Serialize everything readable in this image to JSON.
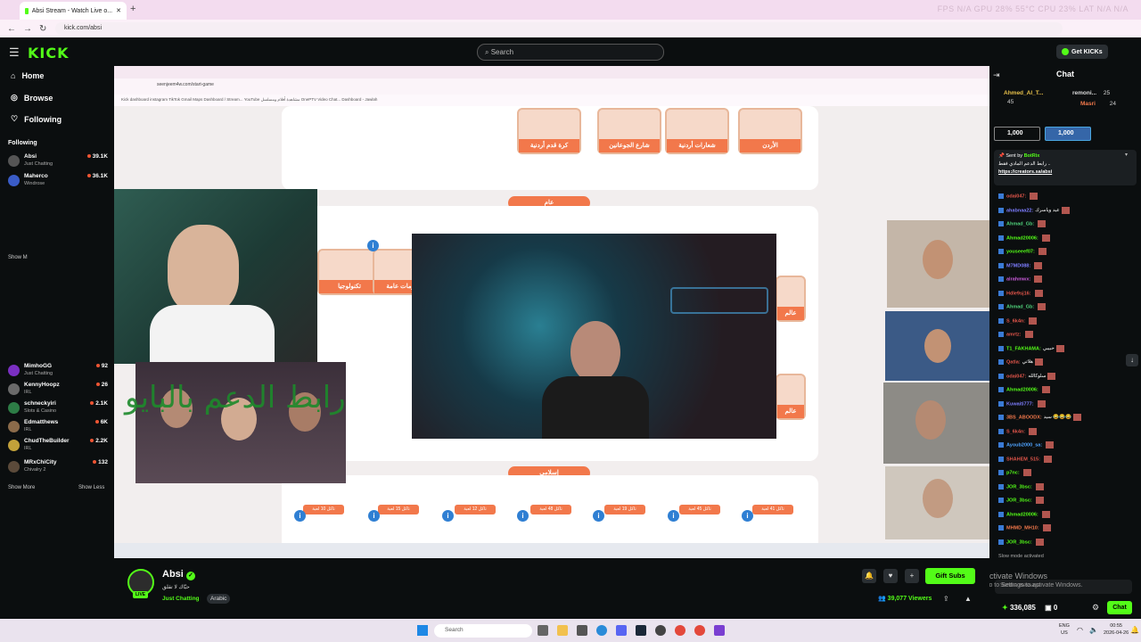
{
  "browser": {
    "tab_title": "Absi Stream - Watch Live o...",
    "url": "kick.com/absi",
    "perf_overlay": "FPS N/A   GPU 28% 55°C   CPU 23%   LAT N/A  N/A"
  },
  "kick": {
    "logo": "KICK",
    "search_placeholder": "Search",
    "get_kicks": "Get KICKs"
  },
  "sidebar": {
    "nav": [
      {
        "label": "Home",
        "icon": "home-icon"
      },
      {
        "label": "Browse",
        "icon": "compass-icon"
      },
      {
        "label": "Following",
        "icon": "heart-icon"
      }
    ],
    "following_header": "Following",
    "following": [
      {
        "name": "Absi",
        "category": "Just Chatting",
        "viewers": "39.1K"
      },
      {
        "name": "Maherco",
        "category": "Windrose",
        "viewers": "36.1K"
      }
    ],
    "recommended": [
      {
        "name": "MimhoGG",
        "category": "Just Chatting",
        "viewers": "92"
      },
      {
        "name": "KennyHoopz",
        "category": "IRL",
        "viewers": "26"
      },
      {
        "name": "schneckyiri",
        "category": "Slots & Casino",
        "viewers": "2.1K"
      },
      {
        "name": "Edmatthews",
        "category": "IRL",
        "viewers": "6K"
      },
      {
        "name": "ChudTheBuilder",
        "category": "IRL",
        "viewers": "2.2K"
      },
      {
        "name": "MRxChiCity",
        "category": "Chivalry 2",
        "viewers": "132"
      }
    ],
    "show_more_1": "Show M",
    "show_more": "Show More",
    "show_less": "Show Less"
  },
  "stream_content": {
    "inner_url": "seenjeem4w.com/start-game",
    "bookmarks": "Kick   dashboard   instagram   TikTok   Gmail   Maps   Dashboard / Stream...   YouTube   مشاهدة أفلام ومسلسل   OnePTV Video Chat...   Dashboard - Jawlah",
    "cards_top": [
      "الأردن",
      "شعارات أردنية",
      "شارع الجوعانين",
      "كرة قدم أردنية"
    ],
    "section_general": "عام",
    "cards_mid": [
      "تكنولوجيا",
      "معلومات عامة",
      "عالم",
      "عالم"
    ],
    "section_islamic": "إسلامي",
    "tags_bottom": [
      "تاكل 10 لعبة",
      "تاكل 15 لعبة",
      "تاكل 12 لعبة",
      "تاكل 48 لعبة",
      "تاكل 19 لعبة",
      "تاكل 45 لعبة",
      "تاكل 41 لعبة"
    ],
    "overlay_arabic": "رابط الدعم بالبايو"
  },
  "stream_info": {
    "name": "Absi",
    "title": "حيّاك لا تقلق",
    "category": "Just Chatting",
    "language": "Arabic",
    "live": "LIVE",
    "gift_subs": "Gift Subs",
    "viewers": "39,077 Viewers"
  },
  "chat": {
    "title": "Chat",
    "top_gifters": [
      {
        "name": "Ahmed_Al_T...",
        "count": "45"
      },
      {
        "name": "remoni...",
        "count": "25"
      },
      {
        "name": "Masri",
        "count": "24"
      }
    ],
    "goal_left": "1,000",
    "goal_right": "1,000",
    "pinned_by": "Sent by",
    "pinned_user": "BotRix",
    "pinned_text": "رابط الدعم المادي فقط ..",
    "pinned_link": "https://creators.sa/absi",
    "pinned_text2": "رابط الدعم المادي باي ...",
    "messages": [
      {
        "user": "odai047:",
        "text": "",
        "color": "#e0554a"
      },
      {
        "user": "ahabnaa22:",
        "text": "عيد وياسرك",
        "color": "#7d7dff"
      },
      {
        "user": "Ahmad_Gb:",
        "text": "",
        "color": "#4fd17a"
      },
      {
        "user": "Ahmad20006:",
        "text": "",
        "color": "#53fc18"
      },
      {
        "user": "youseeef07:",
        "text": "",
        "color": "#53fc18"
      },
      {
        "user": "M7MD088:",
        "text": "",
        "color": "#7d7dff"
      },
      {
        "user": "alrahmwx:",
        "text": "",
        "color": "#c85ad9"
      },
      {
        "user": "HdIe9sj16:",
        "text": "",
        "color": "#e0554a"
      },
      {
        "user": "Ahmad_Gb:",
        "text": "",
        "color": "#4fd17a"
      },
      {
        "user": "S_6k4n:",
        "text": "",
        "color": "#e0554a"
      },
      {
        "user": "amrtz:",
        "text": "",
        "color": "#e0554a"
      },
      {
        "user": "T1_FAKHAMA:",
        "text": "حبيبي",
        "color": "#53fc18"
      },
      {
        "user": "Qatla:",
        "text": "هلاتي",
        "color": "#e0554a"
      },
      {
        "user": "odai047:",
        "text": "سلوكالله",
        "color": "#e0554a"
      },
      {
        "user": "Ahmad20006:",
        "text": "",
        "color": "#53fc18"
      },
      {
        "user": "Kuwaiti777:",
        "text": "",
        "color": "#7d7dff"
      },
      {
        "user": "3BS_ABOODX:",
        "text": "سيد 😂😂😂",
        "color": "#f2784b"
      },
      {
        "user": "S_6k4n:",
        "text": "",
        "color": "#e0554a"
      },
      {
        "user": "Ayoub2000_sa:",
        "text": "",
        "color": "#4fa3ff"
      },
      {
        "user": "SHAHEM_515:",
        "text": "",
        "color": "#e0554a"
      },
      {
        "user": "p7nc:",
        "text": "",
        "color": "#53fc18"
      },
      {
        "user": "JOR_3bsc:",
        "text": "",
        "color": "#53fc18"
      },
      {
        "user": "JOR_3bsc:",
        "text": "",
        "color": "#53fc18"
      },
      {
        "user": "Ahmad20006:",
        "text": "",
        "color": "#53fc18"
      },
      {
        "user": "MHMD_MH10:",
        "text": "",
        "color": "#f2784b"
      },
      {
        "user": "JOR_3bsc:",
        "text": "",
        "color": "#53fc18"
      }
    ],
    "slow_mode": "Slow mode activated",
    "input_placeholder": "Send a message",
    "points": "336,085",
    "points2": "0",
    "send": "Chat"
  },
  "windows": {
    "activate_title": "Activate Windows",
    "activate_sub": "Go to Settings to activate Windows.",
    "search": "Search",
    "lang_top": "ENG",
    "lang_bottom": "US",
    "time": "00:55",
    "date": "2026-04-26"
  },
  "colors": {
    "kick_green": "#53fc18",
    "accent_orange": "#f2784b",
    "bg": "#0b0e0f"
  }
}
